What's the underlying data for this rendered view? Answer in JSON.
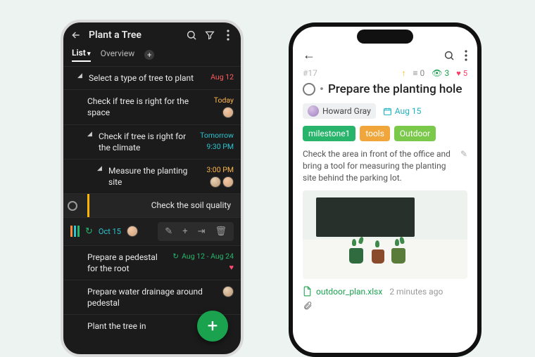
{
  "left": {
    "title": "Plant a Tree",
    "tabs": {
      "list": "List",
      "overview": "Overview"
    },
    "rows": [
      {
        "text": "Select a type of tree to plant",
        "date": "Aug 12"
      },
      {
        "text": "Check if tree is right for the space",
        "date": "Today"
      },
      {
        "text": "Check if tree is right for the climate",
        "date": "Tomorrow",
        "time": "9:30 PM"
      },
      {
        "text": "Measure the planting site",
        "date": "3:00 PM"
      },
      {
        "text": "Check the soil quality"
      },
      {
        "text": "Prepare a pedestal for the root",
        "date": "Aug 12 - Aug 24"
      },
      {
        "text": "Prepare water drainage around pedestal"
      },
      {
        "text": "Plant the tree in"
      }
    ],
    "toolbar_date": "Oct 15"
  },
  "right": {
    "id": "#17",
    "counts": {
      "list": "0",
      "watch": "3",
      "like": "5"
    },
    "title": "Prepare the planting hole",
    "assignee": "Howard Gray",
    "due": "Aug 15",
    "tags": [
      "milestone1",
      "tools",
      "Outdoor"
    ],
    "desc": "Check the area in front of the office and bring a tool for measuring the planting site behind the parking lot.",
    "attachment": {
      "name": "outdoor_plan.xlsx",
      "ago": "2 minutes ago"
    }
  }
}
